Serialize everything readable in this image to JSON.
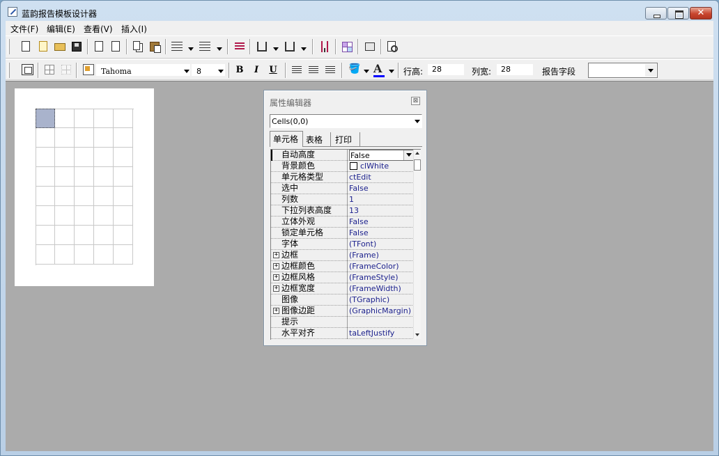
{
  "window": {
    "title": "蓝韵报告模板设计器"
  },
  "menu": [
    "文件(F)",
    "编辑(E)",
    "查看(V)",
    "插入(I)"
  ],
  "toolbar2": {
    "font_name": "Tahoma",
    "font_size": "8",
    "bold": "B",
    "italic": "I",
    "underline": "U",
    "font_color_glyph": "A",
    "font_color": "#0000ff",
    "row_height_label": "行高:",
    "row_height_value": "28",
    "col_width_label": "列宽:",
    "col_width_value": "28",
    "report_field_label": "报告字段",
    "report_field_value": ""
  },
  "canvas": {
    "grid_cols": 5,
    "grid_rows": 8,
    "selected_cell": [
      0,
      0
    ],
    "selected_color": "#a9b3cc"
  },
  "inspector": {
    "title": "属性编辑器",
    "close_glyph": "⊠",
    "object": "Cells(0,0)",
    "tabs": [
      "单元格",
      "表格",
      "打印"
    ],
    "active_tab": "单元格",
    "properties": [
      {
        "name": "自动高度",
        "value": "False",
        "expandable": false
      },
      {
        "name": "背景颜色",
        "value": "clWhite",
        "expandable": false,
        "swatch": "#ffffff"
      },
      {
        "name": "单元格类型",
        "value": "ctEdit",
        "expandable": false
      },
      {
        "name": "选中",
        "value": "False",
        "expandable": false
      },
      {
        "name": "列数",
        "value": "1",
        "expandable": false
      },
      {
        "name": "下拉列表高度",
        "value": "13",
        "expandable": false
      },
      {
        "name": "立体外观",
        "value": "False",
        "expandable": false
      },
      {
        "name": "锁定单元格",
        "value": "False",
        "expandable": false
      },
      {
        "name": "字体",
        "value": "(TFont)",
        "expandable": false
      },
      {
        "name": "边框",
        "value": "(Frame)",
        "expandable": true
      },
      {
        "name": "边框颜色",
        "value": "(FrameColor)",
        "expandable": true
      },
      {
        "name": "边框风格",
        "value": "(FrameStyle)",
        "expandable": true
      },
      {
        "name": "边框宽度",
        "value": "(FrameWidth)",
        "expandable": true
      },
      {
        "name": "图像",
        "value": "(TGraphic)",
        "expandable": false
      },
      {
        "name": "图像边距",
        "value": "(GraphicMargin)",
        "expandable": true
      },
      {
        "name": "提示",
        "value": "",
        "expandable": false
      },
      {
        "name": "水平对齐",
        "value": "taLeftJustify",
        "expandable": false
      }
    ]
  }
}
